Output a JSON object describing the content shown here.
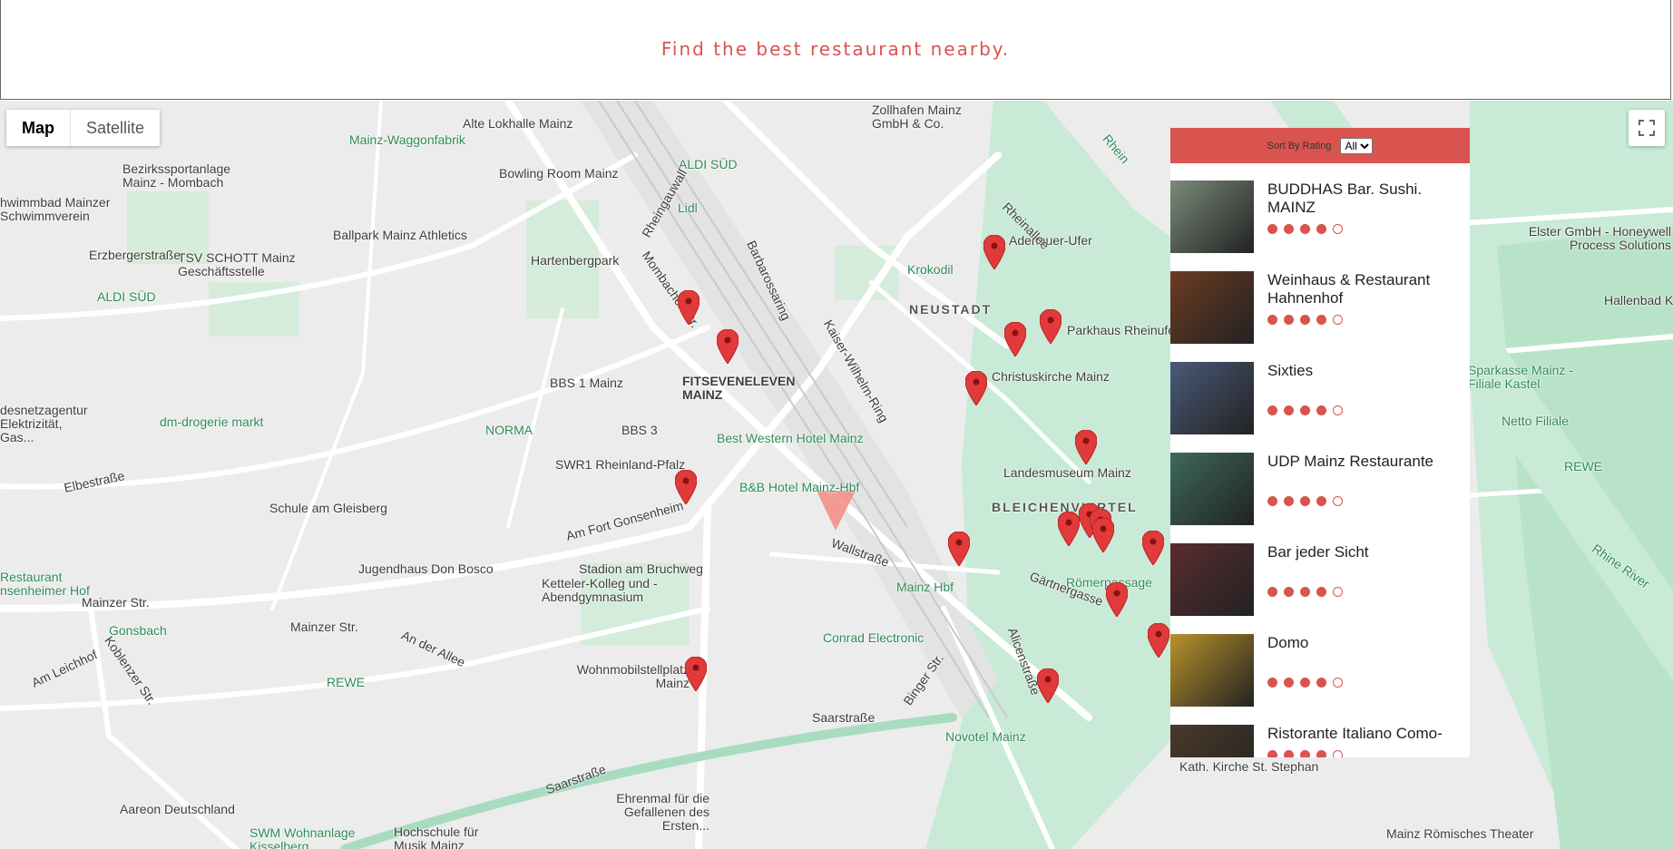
{
  "header": {
    "title": "Find the best restaurant nearby."
  },
  "map_controls": {
    "map_label": "Map",
    "satellite_label": "Satellite"
  },
  "map_labels": {
    "alte_lokhalle": "Alte Lokhalle Mainz",
    "zollhafen": "Zollhafen Mainz GmbH & Co.",
    "waggonfabrik": "Mainz-Waggonfabrik",
    "bowling": "Bowling Room Mainz",
    "aldi_sued_1": "ALDI SÜD",
    "lidl": "Lidl",
    "bezirks": "Bezirkssportanlage Mainz - Mombach",
    "schwimmbad": "hwimmbad Mainzer Schwimmverein",
    "ballpark": "Ballpark Mainz Athletics",
    "tsv": "TSV SCHOTT Mainz Geschäftsstelle",
    "hartenbergpark": "Hartenbergpark",
    "krokodil": "Krokodil",
    "adenauer": "Adenauer-Ufer",
    "neustadt": "NEUSTADT",
    "parkhaus": "Parkhaus Rheinufer",
    "christuskirche": "Christuskirche Mainz",
    "bbs": "BBS 1 Mainz",
    "fitseveneleven": "FITSEVENELEVEN MAINZ",
    "norma": "NORMA",
    "bbs3": "BBS 3",
    "dm": "dm-drogerie markt",
    "best_western": "Best Western Hotel Mainz",
    "swr": "SWR1 Rheinland-Pfalz",
    "bb_hotel": "B&B Hotel Mainz-Hbf",
    "landesmuseum": "Landesmuseum Mainz",
    "bleichenviertel": "BLEICHENVIERTEL",
    "schule": "Schule am Gleisberg",
    "jugendhaus": "Jugendhaus Don Bosco",
    "stadion": "Stadion am Bruchweg",
    "ketteler": "Ketteler-Kolleg und -Abendgymnasium",
    "mainz_hbf": "Mainz Hbf",
    "roemerpassage": "Römerpassage",
    "conrad": "Conrad Electronic",
    "wohnmobil": "Wohnmobilstellplatz Mainz",
    "rewe": "REWE",
    "novotel": "Novotel Mainz",
    "kath_kirche": "Kath. Kirche St. Stephan",
    "ehrenmal": "Ehrenmal für die Gefallenen des Ersten...",
    "aareon": "Aareon Deutschland",
    "swm": "SWM Wohnanlage Kisselberg",
    "hochschule": "Hochschule für Musik Mainz",
    "elster": "Elster GmbH - Honeywell Process Solutions",
    "hallenbad": "Hallenbad K",
    "sparkasse": "Sparkasse Mainz - Filiale Kastel",
    "netto": "Netto Filiale",
    "rewe2": "REWE",
    "rhine_river": "Rhine River",
    "rhein": "Rhein",
    "restaurant_hof": "Restaurant nsenheimer Hof",
    "aldi_sued_2": "ALDI SÜD",
    "elektrizitaet": "desnetzagentur Elektrizität, Gas...",
    "roemisches_theater": "Mainz Römisches Theater",
    "gonsbach": "Gonsbach",
    "mainzer_str": "Mainzer Str.",
    "saarstrasse": "Saarstraße",
    "erzbergerstrasse": "Erzbergerstraße",
    "elbestrasse": "Elbestraße",
    "koblenzer": "Koblenzer Str.",
    "wallstrasse": "Wallstraße",
    "rheinallee": "Rheinallee",
    "kaiser_wilhelm": "Kaiser-Wilhelm-Ring",
    "alicenstrasse": "Alicenstraße",
    "am_fort": "Am Fort Gonsenheim",
    "gaertnergasse": "Gärtnergasse",
    "binger": "Binger Str.",
    "an_der_allee": "An der Allee",
    "barbarossaring": "Barbarossaring",
    "mombacher": "Mombacher Str.",
    "rheingauwall": "Rheingauwall",
    "am_leichhof": "Am Leichhof"
  },
  "sort": {
    "label": "Sort By Rating",
    "selected": "All"
  },
  "restaurants": [
    {
      "name": "BUDDHAS Bar. Sushi. MAINZ",
      "rating": 4,
      "max": 5,
      "thumb_color": "#7a8b7a"
    },
    {
      "name": "Weinhaus & Restaurant Hahnenhof",
      "rating": 4,
      "max": 5,
      "thumb_color": "#6b3b22"
    },
    {
      "name": "Sixties",
      "rating": 4,
      "max": 5,
      "thumb_color": "#4a5a78"
    },
    {
      "name": "UDP Mainz Restaurante",
      "rating": 4,
      "max": 5,
      "thumb_color": "#3d6a5a"
    },
    {
      "name": "Bar jeder Sicht",
      "rating": 4,
      "max": 5,
      "thumb_color": "#5a2c30"
    },
    {
      "name": "Domo",
      "rating": 4,
      "max": 5,
      "thumb_color": "#b8922a"
    },
    {
      "name": "Ristorante Italiano Como-",
      "rating": 4,
      "max": 5,
      "thumb_color": "#4a3a2a"
    }
  ],
  "colors": {
    "accent": "#d9534f",
    "park": "#c8e6c9",
    "water": "#aadaff",
    "road": "#ffffff"
  }
}
